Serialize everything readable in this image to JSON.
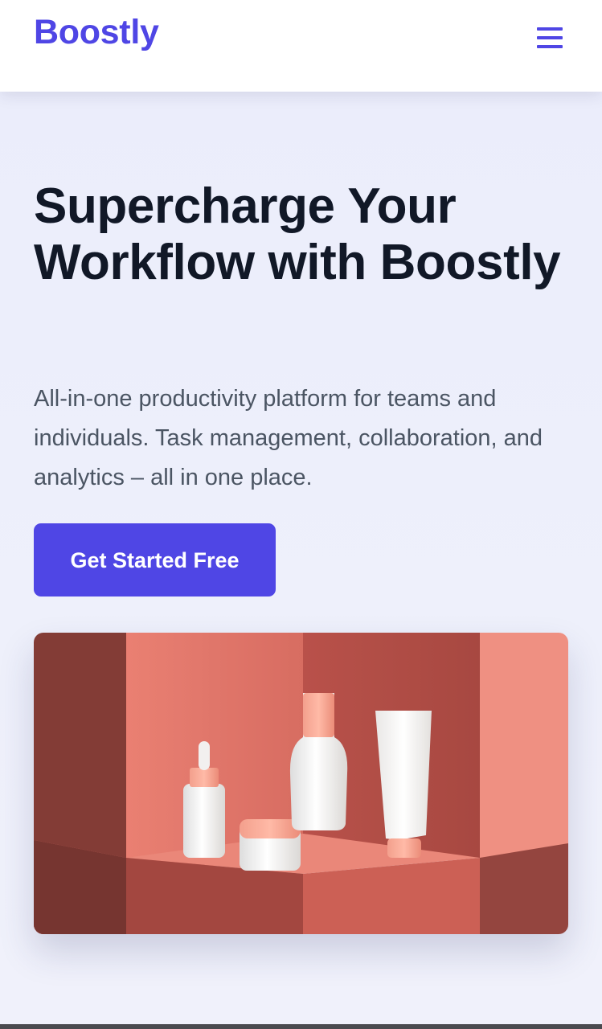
{
  "header": {
    "logo": "Boostly",
    "menu_icon": "hamburger-icon"
  },
  "hero": {
    "headline": "Supercharge Your Workflow with Boostly",
    "subtext": "All-in-one productivity platform for teams and individuals. Task management, collaboration, and analytics – all in one place.",
    "cta_label": "Get Started Free",
    "image_icon": "product-photo"
  },
  "colors": {
    "brand": "#4f46e5",
    "heading": "#111827",
    "body_text": "#4b5563",
    "background": "#eef0fb"
  }
}
